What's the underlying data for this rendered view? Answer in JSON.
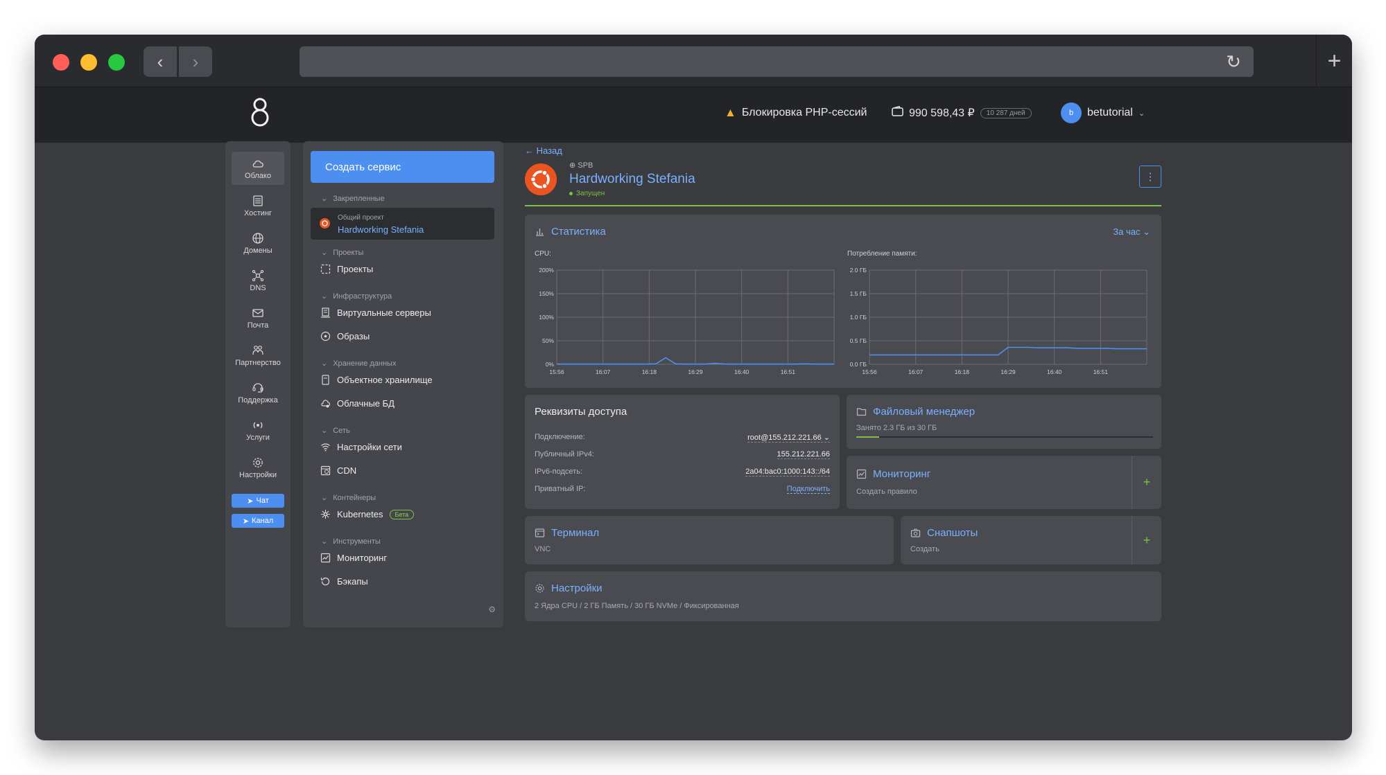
{
  "browser": {
    "back_glyph": "‹",
    "forward_glyph": "›",
    "reload_glyph": "↻",
    "newtab_glyph": "+"
  },
  "header": {
    "warning": "Блокировка PHP-сессий",
    "balance": "990 598,43 ₽",
    "days": "10 287 дней",
    "username": "betutorial",
    "avatar_letter": "b"
  },
  "rail": {
    "items": [
      {
        "label": "Облако",
        "icon": "cloud-icon"
      },
      {
        "label": "Хостинг",
        "icon": "server-icon"
      },
      {
        "label": "Домены",
        "icon": "globe-icon"
      },
      {
        "label": "DNS",
        "icon": "dns-icon"
      },
      {
        "label": "Почта",
        "icon": "mail-icon"
      },
      {
        "label": "Партнерство",
        "icon": "partners-icon"
      },
      {
        "label": "Поддержка",
        "icon": "support-icon"
      },
      {
        "label": "Услуги",
        "icon": "services-icon"
      },
      {
        "label": "Настройки",
        "icon": "gear-icon"
      }
    ],
    "chat": "Чат",
    "channel": "Канал"
  },
  "menu": {
    "create": "Создать сервис",
    "sections": {
      "pinned": "Закрепленные",
      "projects": "Проекты",
      "infrastructure": "Инфраструктура",
      "storage": "Хранение данных",
      "network": "Сеть",
      "containers": "Контейнеры",
      "tools": "Инструменты"
    },
    "pinned_item": {
      "subtitle": "Общий проект",
      "title": "Hardworking Stefania"
    },
    "items": {
      "projects": "Проекты",
      "vps": "Виртуальные серверы",
      "images": "Образы",
      "object_storage": "Объектное хранилище",
      "cloud_db": "Облачные БД",
      "network_settings": "Настройки сети",
      "cdn": "CDN",
      "kubernetes": "Kubernetes",
      "beta": "Бета",
      "monitoring": "Мониторинг",
      "backups": "Бэкапы"
    }
  },
  "server": {
    "back": "← Назад",
    "region": "SPB",
    "name": "Hardworking Stefania",
    "status": "Запущен",
    "menu_glyph": "⋮"
  },
  "stats": {
    "title": "Статистика",
    "period": "За час ⌄",
    "cpu_label": "CPU:",
    "mem_label": "Потребление памяти:"
  },
  "chart_data": [
    {
      "type": "line",
      "title": "CPU:",
      "x": [
        "15:56",
        "16:07",
        "16:18",
        "16:29",
        "16:40",
        "16:51"
      ],
      "y_ticks": [
        "200%",
        "150%",
        "100%",
        "50%",
        "0%"
      ],
      "ylim": [
        0,
        200
      ],
      "series": [
        {
          "values": [
            0.5,
            0.5,
            0.5,
            0.5,
            0.5,
            0.5,
            0.5,
            0.5,
            0.5,
            0.5,
            1,
            14,
            1,
            0.5,
            0.5,
            0.5,
            2,
            0.5,
            0.5,
            0.5,
            0.5,
            0.5,
            0.5,
            0.5,
            0.5,
            1,
            0.5,
            0.5,
            0.5
          ]
        }
      ],
      "grid": true,
      "color": "#4d8ff0"
    },
    {
      "type": "line",
      "title": "Потребление памяти:",
      "x": [
        "15:56",
        "16:07",
        "16:18",
        "16:29",
        "16:40",
        "16:51"
      ],
      "y_ticks": [
        "2.0 ГБ",
        "1.5 ГБ",
        "1.0 ГБ",
        "0.5 ГБ",
        "0.0 ГБ"
      ],
      "ylim": [
        0,
        2
      ],
      "series": [
        {
          "values": [
            0.2,
            0.2,
            0.2,
            0.2,
            0.2,
            0.2,
            0.2,
            0.2,
            0.2,
            0.2,
            0.2,
            0.2,
            0.2,
            0.2,
            0.36,
            0.36,
            0.36,
            0.35,
            0.35,
            0.35,
            0.35,
            0.34,
            0.34,
            0.34,
            0.34,
            0.33,
            0.33,
            0.33,
            0.33
          ]
        }
      ],
      "grid": true,
      "color": "#4d8ff0"
    }
  ],
  "credentials": {
    "title": "Реквизиты доступа",
    "rows": [
      {
        "label": "Подключение:",
        "value": "root@155.212.221.66 ⌄"
      },
      {
        "label": "Публичный IPv4:",
        "value": "155.212.221.66"
      },
      {
        "label": "IPv6-подсеть:",
        "value": "2a04:bac0:1000:143::/64"
      },
      {
        "label": "Приватный IP:",
        "value": "Подключить"
      }
    ]
  },
  "file_manager": {
    "title": "Файловый менеджер",
    "usage": "Занято 2.3 ГБ из 30 ГБ",
    "used_fraction": 0.077
  },
  "monitoring": {
    "title": "Мониторинг",
    "sub": "Создать правило",
    "plus": "+"
  },
  "terminal": {
    "title": "Терминал",
    "sub": "VNC"
  },
  "snapshots": {
    "title": "Снапшоты",
    "sub": "Создать",
    "plus": "+"
  },
  "settings": {
    "title": "Настройки",
    "sub": "2 Ядра CPU / 2 ГБ Память / 30 ГБ NVMe / Фиксированная"
  }
}
